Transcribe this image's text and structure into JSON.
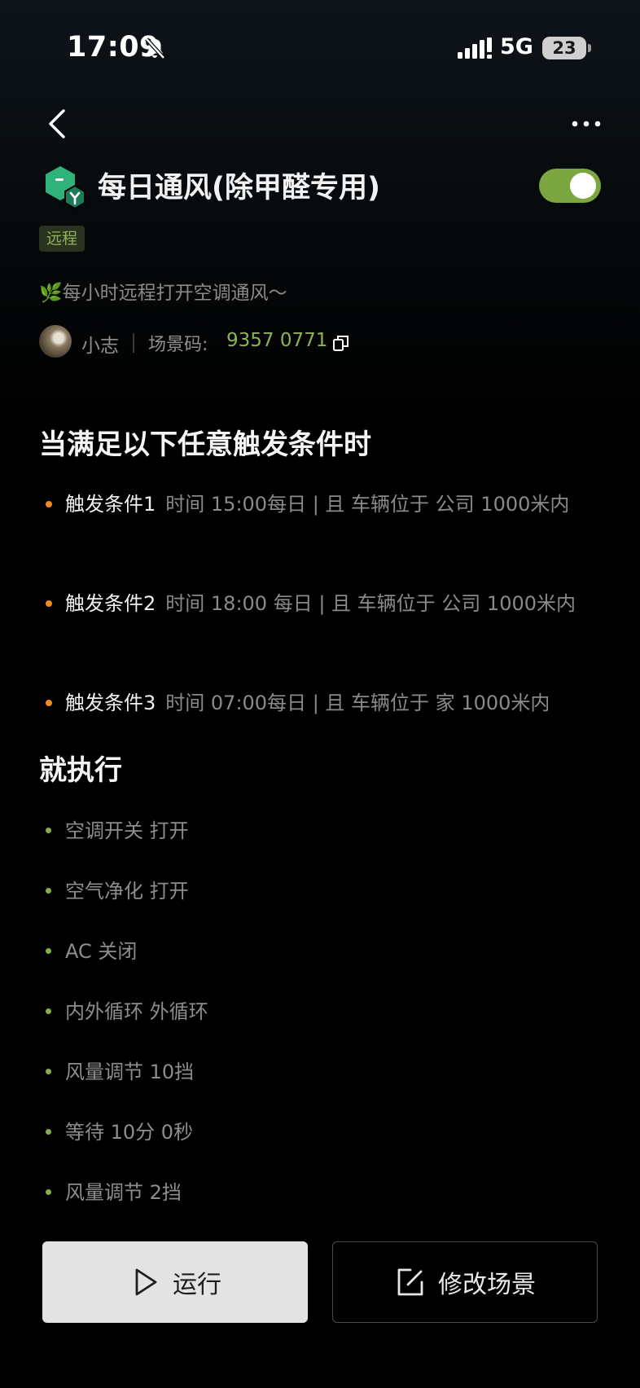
{
  "status_bar": {
    "time": "17:09",
    "network": "5G",
    "battery": "23"
  },
  "scene": {
    "title": "每日通风(除甲醛专用)",
    "enabled": true,
    "tag": "远程",
    "description_icon": "🌿",
    "description": "每小时远程打开空调通风～",
    "owner": "小志",
    "code_label": "场景码:",
    "code_value": "9357 0771"
  },
  "conditions_section": {
    "title": "当满足以下任意触发条件时",
    "items": [
      {
        "name": "触发条件1",
        "text": "时间 15:00每日 | 且 车辆位于 公司 1000米内"
      },
      {
        "name": "触发条件2",
        "text": "时间 18:00 每日 | 且 车辆位于 公司 1000米内"
      },
      {
        "name": "触发条件3",
        "text": "时间 07:00每日 | 且 车辆位于 家 1000米内"
      }
    ]
  },
  "actions_section": {
    "title": "就执行",
    "items": [
      "空调开关 打开",
      "空气净化 打开",
      "AC 关闭",
      "内外循环 外循环",
      "风量调节 10挡",
      "等待 10分 0秒",
      "风量调节 2挡"
    ]
  },
  "buttons": {
    "run": "运行",
    "edit": "修改场景"
  },
  "colors": {
    "accent_green": "#8fb353",
    "toggle_on": "#7ca63f",
    "condition_dot": "#f08a24",
    "action_dot": "#86b04a"
  }
}
